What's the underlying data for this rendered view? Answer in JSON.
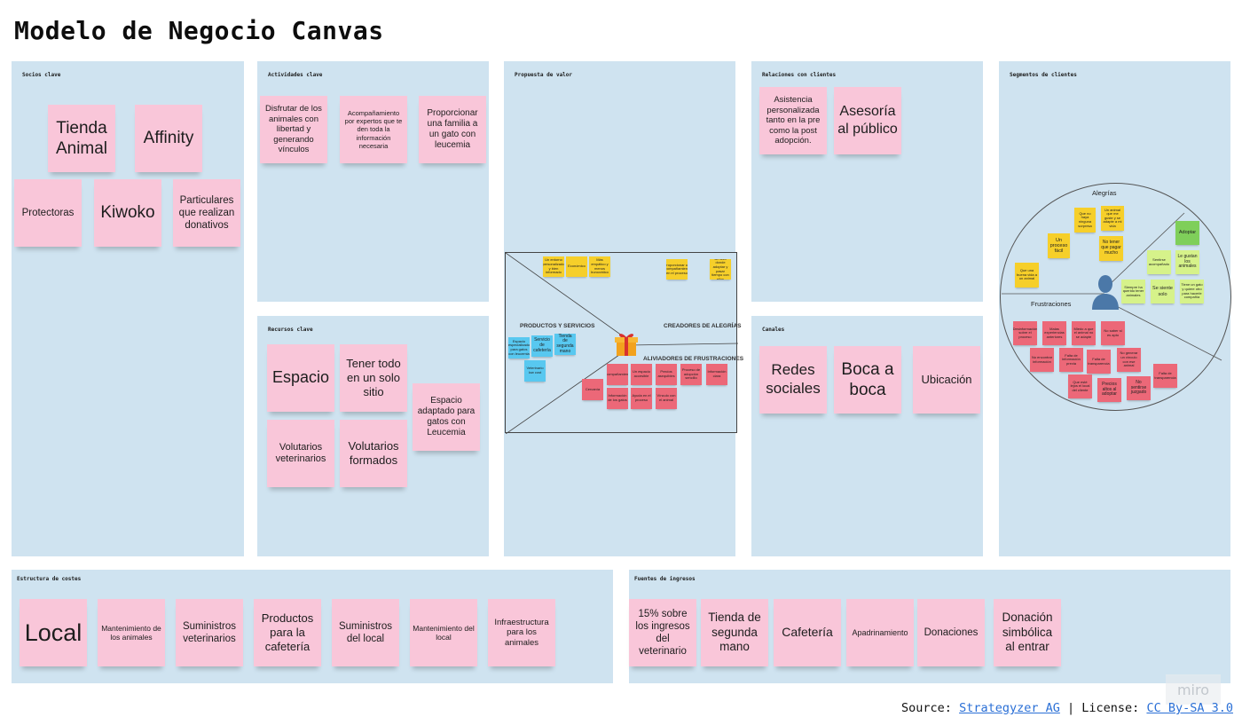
{
  "title": "Modelo de Negocio Canvas",
  "sections": {
    "socios": "Socios clave",
    "actividades": "Actividades clave",
    "propuesta": "Propuesta de valor",
    "relaciones": "Relaciones con clientes",
    "segmentos": "Segmentos de clientes",
    "recursos": "Recursos clave",
    "canales": "Canales",
    "costes": "Estructura de costes",
    "ingresos": "Fuentes de ingresos"
  },
  "socios_notes": [
    "Tienda Animal",
    "Affinity",
    "Protectoras",
    "Kiwoko",
    "Particulares que realizan donativos"
  ],
  "actividades_notes": [
    "Disfrutar de los animales con libertad y generando vínculos",
    "Acompañamiento por expertos que te den toda la información necesaria",
    "Proporcionar una familia a un gato con leucemia"
  ],
  "recursos_notes": [
    "Espacio",
    "Tener todo en un solo sitio",
    "Espacio adaptado para gatos con Leucemia",
    "Volutarios veterinarios",
    "Volutarios formados"
  ],
  "relaciones_notes": [
    "Asistencia personalizada tanto en la pre como la post adopción.",
    "Asesoría al público"
  ],
  "canales_notes": [
    "Redes sociales",
    "Boca a boca",
    "Ubicación"
  ],
  "costes_notes": [
    "Local",
    "Mantenimiento de los animales",
    "Suministros veterinarios",
    "Productos para la cafetería",
    "Suministros del local",
    "Mantenimiento del local",
    "Infraestructura para los animales"
  ],
  "ingresos_notes": [
    "15% sobre los ingresos del veterinario",
    "Tienda de segunda mano",
    "Cafetería",
    "Apadrinamiento",
    "Donaciones",
    "Donación simbólica al entrar"
  ],
  "value_map": {
    "productos": "PRODUCTOS Y SERVICIOS",
    "creadores": "CREADORES DE ALEGRÍAS",
    "aliviadores": "ALIVIADORES DE FRUSTRACIONES",
    "products_notes": [
      "Espacio especializado para gatos con leucemia",
      "Servicio de cafetería",
      "Tienda de segunda mano",
      "Veterinario low cost"
    ],
    "gains_notes": [
      "Un entorno personalizado y bien informado",
      "Económico",
      "Más empático y menos burocrático",
      "Proporcionar un acompañamiento en el proceso",
      "Un sitio donde adoptar y pasar tiempo con ellos"
    ],
    "pains_notes": [
      "Acompañamiento",
      "Un espacio accesible",
      "Precios asequibles",
      "Proceso de adopción sencillo",
      "Información clara",
      "Cercanía",
      "Información de los gatos",
      "Ayuda en el proceso",
      "Vínculo con el animal",
      "Buen trato",
      "Atención personal"
    ]
  },
  "customer_profile": {
    "alegrias": "Alegrías",
    "frustraciones": "Frustraciones",
    "gains_notes": [
      "Que no haya ninguna sorpresa",
      "Un animal que me guste y se adapte a mi vida",
      "Un proceso fácil",
      "No tener que pagar mucho",
      "Que una buena vida a un animal",
      "Adoptar",
      "Sentirse acompañado",
      "Le gustan los animales",
      "Siempre ha querido tener animales",
      "Se siente solo",
      "Tiene un gato y quiere otro para hacerle compañía"
    ],
    "pains_notes": [
      "Desinformación sobre el proceso",
      "Malas experiencias anteriores",
      "Miedo a que el animal no se adapte",
      "No saber si es apto",
      "No encontrar información",
      "Falta de información previa",
      "Falta de transparencia",
      "No generar un vínculo con ese animal",
      "Que esté lejos el local del cliente",
      "Precios altos al adoptar",
      "No sentirse juzgado",
      "Falta de transparencia"
    ]
  },
  "footer": {
    "source_label": "Source:",
    "source_link": "Strategyzer AG",
    "separator": "|",
    "license_label": "License:",
    "license_link": "CC By-SA 3.0"
  },
  "watermark": "miro"
}
